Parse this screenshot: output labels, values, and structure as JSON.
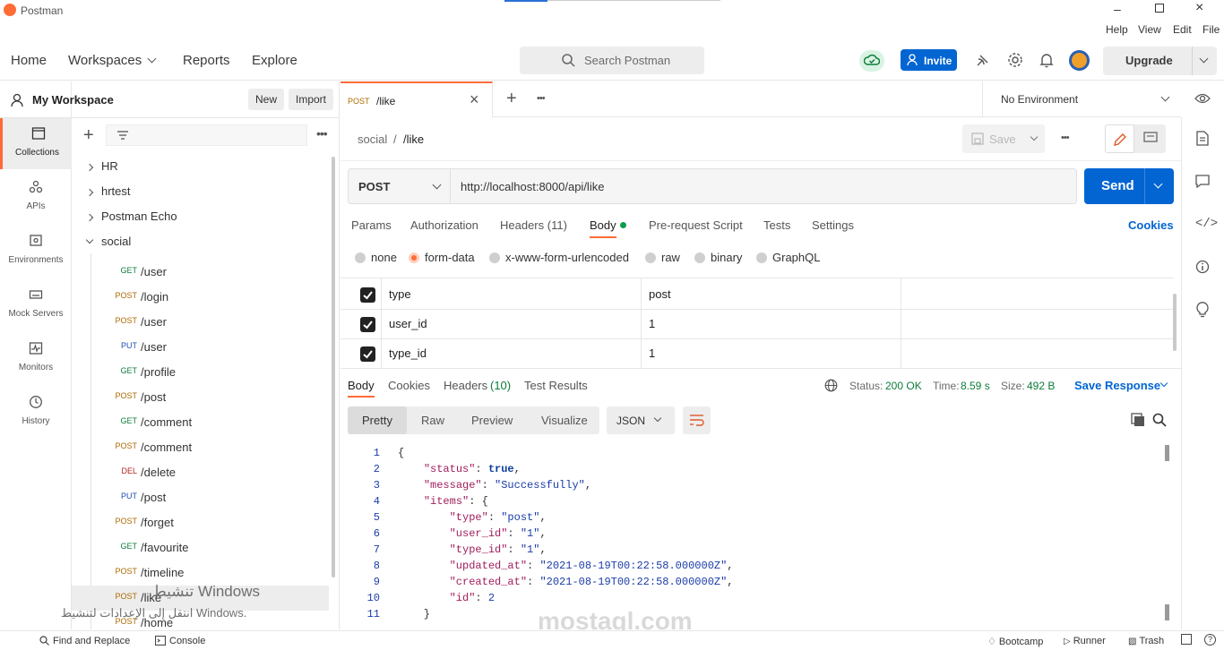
{
  "app": {
    "title": "Postman",
    "menu": [
      "Help",
      "View",
      "Edit",
      "File"
    ]
  },
  "header": {
    "nav": [
      "Home",
      "Workspaces",
      "Reports",
      "Explore"
    ],
    "search_placeholder": "Search Postman",
    "invite_label": "Invite",
    "upgrade_label": "Upgrade"
  },
  "leftbar": {
    "items": [
      "Collections",
      "APIs",
      "Environments",
      "Mock Servers",
      "Monitors",
      "History"
    ]
  },
  "sidebar": {
    "workspace": "My Workspace",
    "new_label": "New",
    "import_label": "Import",
    "collections": [
      "HR",
      "hrtest",
      "Postman Echo",
      "social"
    ],
    "requests": [
      {
        "method": "GET",
        "path": "/user"
      },
      {
        "method": "POST",
        "path": "/login"
      },
      {
        "method": "POST",
        "path": "/user"
      },
      {
        "method": "PUT",
        "path": "/user"
      },
      {
        "method": "GET",
        "path": "/profile"
      },
      {
        "method": "POST",
        "path": "/post"
      },
      {
        "method": "GET",
        "path": "/comment"
      },
      {
        "method": "POST",
        "path": "/comment"
      },
      {
        "method": "DEL",
        "path": "/delete"
      },
      {
        "method": "PUT",
        "path": "/post"
      },
      {
        "method": "POST",
        "path": "/forget"
      },
      {
        "method": "GET",
        "path": "/favourite"
      },
      {
        "method": "POST",
        "path": "/timeline"
      },
      {
        "method": "POST",
        "path": "/like"
      },
      {
        "method": "POST",
        "path": "/home"
      }
    ]
  },
  "tabbar": {
    "active_tab_method": "POST",
    "active_tab_path": "/like",
    "environment": "No Environment"
  },
  "request": {
    "breadcrumb_collection": "social",
    "breadcrumb_sep": "/",
    "breadcrumb_request": "/like",
    "save_label": "Save",
    "method": "POST",
    "url": "http://localhost:8000/api/like",
    "send_label": "Send",
    "tabs": [
      "Params",
      "Authorization",
      "Headers (11)",
      "Body",
      "Pre-request Script",
      "Tests",
      "Settings"
    ],
    "cookies_label": "Cookies",
    "body_modes": [
      "none",
      "form-data",
      "x-www-form-urlencoded",
      "raw",
      "binary",
      "GraphQL"
    ],
    "form_rows": [
      {
        "key": "type",
        "value": "post"
      },
      {
        "key": "user_id",
        "value": "1"
      },
      {
        "key": "type_id",
        "value": "1"
      }
    ]
  },
  "response": {
    "tabs": [
      "Body",
      "Cookies",
      "Headers",
      "Test Results"
    ],
    "headers_count": "(10)",
    "status_label": "Status:",
    "status_value": "200 OK",
    "time_label": "Time:",
    "time_value": "8.59 s",
    "size_label": "Size:",
    "size_value": "492 B",
    "save_response": "Save Response",
    "view_modes": [
      "Pretty",
      "Raw",
      "Preview",
      "Visualize"
    ],
    "format": "JSON",
    "code_lines": [
      "{",
      "    \"status\": true,",
      "    \"message\": \"Successfully\",",
      "    \"items\": {",
      "        \"type\": \"post\",",
      "        \"user_id\": \"1\",",
      "        \"type_id\": \"1\",",
      "        \"updated_at\": \"2021-08-19T00:22:58.000000Z\",",
      "        \"created_at\": \"2021-08-19T00:22:58.000000Z\",",
      "        \"id\": 2",
      "    }"
    ]
  },
  "footer": {
    "find_replace": "Find and Replace",
    "console": "Console",
    "bootcamp": "Bootcamp",
    "runner": "Runner",
    "trash": "Trash"
  },
  "overlay": {
    "activate_title": "تنشيط Windows",
    "activate_sub": "انتقل إلى الإعدادات لتنشيط Windows.",
    "watermark": "mostaql.com"
  }
}
